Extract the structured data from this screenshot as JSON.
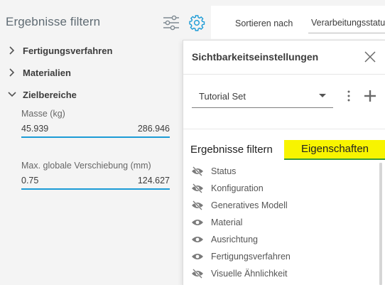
{
  "left_panel": {
    "title": "Ergebnisse filtern",
    "sections": [
      {
        "label": "Fertigungsverfahren",
        "expanded": false
      },
      {
        "label": "Materialien",
        "expanded": false
      },
      {
        "label": "Zielbereiche",
        "expanded": true
      }
    ],
    "ranges": [
      {
        "label": "Masse (kg)",
        "min": "45.939",
        "max": "286.946"
      },
      {
        "label": "Max. globale Verschiebung (mm)",
        "min": "0.75",
        "max": "124.627"
      }
    ]
  },
  "topbar": {
    "sort_label": "Sortieren nach",
    "sort_value": "Verarbeitungsstatus"
  },
  "popup": {
    "title": "Sichtbarkeitseinstellungen",
    "set_value": "Tutorial Set",
    "tabs": {
      "filter": "Ergebnisse filtern",
      "properties": "Eigenschaften"
    },
    "properties": [
      {
        "label": "Status",
        "visible": false
      },
      {
        "label": "Konfiguration",
        "visible": false
      },
      {
        "label": "Generatives Modell",
        "visible": false
      },
      {
        "label": "Material",
        "visible": true
      },
      {
        "label": "Ausrichtung",
        "visible": true
      },
      {
        "label": "Fertigungsverfahren",
        "visible": true
      },
      {
        "label": "Visuelle Ähnlichkeit",
        "visible": false
      }
    ]
  },
  "colors": {
    "accent_blue": "#1c9bd6",
    "tab_highlight": "#f8f400",
    "tab_underline": "#3a9a3a",
    "icon_gray": "#777777"
  }
}
